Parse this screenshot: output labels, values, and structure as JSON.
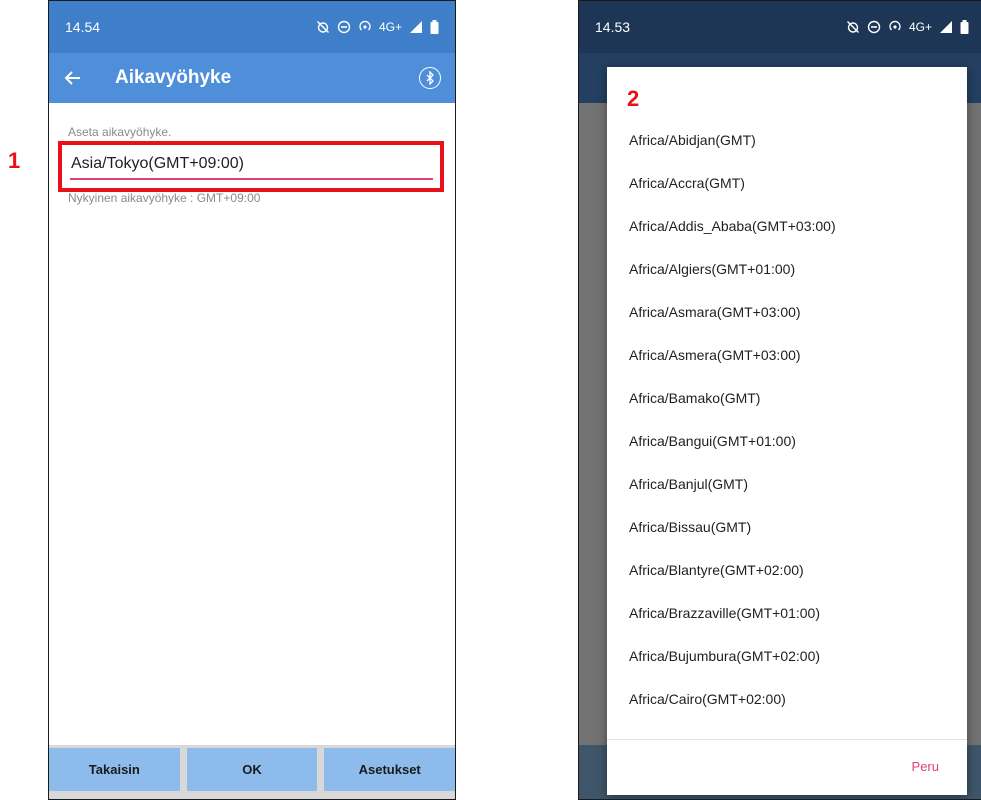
{
  "markers": {
    "first": "1",
    "second": "2"
  },
  "colors": {
    "appbar": "#4f8fda",
    "statusbar_left": "#3f7fca",
    "statusbar_right": "#1e3656",
    "accent_pink": "#e0407a",
    "highlight_red": "#e8111a",
    "button_blue": "#8dbcec"
  },
  "left_screen": {
    "status_time": "14.54",
    "status_network": "4G+",
    "title": "Aikavyöhyke",
    "set_label": "Aseta aikavyöhyke.",
    "timezone_value": "Asia/Tokyo(GMT+09:00)",
    "current_tz": "Nykyinen aikavyöhyke : GMT+09:00",
    "buttons": {
      "back": "Takaisin",
      "ok": "OK",
      "settings": "Asetukset"
    }
  },
  "right_screen": {
    "status_time": "14.53",
    "status_network": "4G+",
    "cancel_label": "Peru",
    "timezones": [
      "Africa/Abidjan(GMT)",
      "Africa/Accra(GMT)",
      "Africa/Addis_Ababa(GMT+03:00)",
      "Africa/Algiers(GMT+01:00)",
      "Africa/Asmara(GMT+03:00)",
      "Africa/Asmera(GMT+03:00)",
      "Africa/Bamako(GMT)",
      "Africa/Bangui(GMT+01:00)",
      "Africa/Banjul(GMT)",
      "Africa/Bissau(GMT)",
      "Africa/Blantyre(GMT+02:00)",
      "Africa/Brazzaville(GMT+01:00)",
      "Africa/Bujumbura(GMT+02:00)",
      "Africa/Cairo(GMT+02:00)"
    ]
  }
}
